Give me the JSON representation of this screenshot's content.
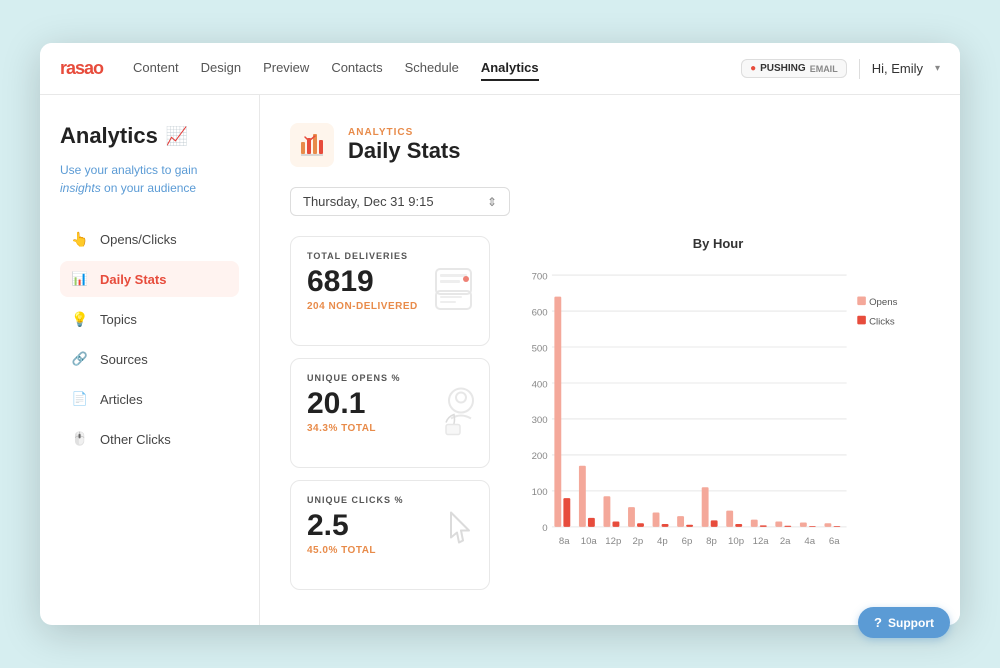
{
  "app": {
    "logo": "rasa",
    "logo_dot": "o"
  },
  "nav": {
    "links": [
      {
        "label": "Content",
        "active": false
      },
      {
        "label": "Design",
        "active": false
      },
      {
        "label": "Preview",
        "active": false
      },
      {
        "label": "Contacts",
        "active": false
      },
      {
        "label": "Schedule",
        "active": false
      },
      {
        "label": "Analytics",
        "active": true
      }
    ],
    "badge_text": "PUSHING",
    "user": "Hi, Emily"
  },
  "sidebar": {
    "title": "Analytics",
    "subtitle_1": "Use your analytics to gain",
    "subtitle_highlight": "insights",
    "subtitle_2": "on your audience",
    "items": [
      {
        "label": "Opens/Clicks",
        "icon": "👆",
        "active": false
      },
      {
        "label": "Daily Stats",
        "icon": "📊",
        "active": true
      },
      {
        "label": "Topics",
        "icon": "💡",
        "active": false
      },
      {
        "label": "Sources",
        "icon": "🔗",
        "active": false
      },
      {
        "label": "Articles",
        "icon": "📄",
        "active": false
      },
      {
        "label": "Other Clicks",
        "icon": "🖱️",
        "active": false
      }
    ]
  },
  "content": {
    "breadcrumb": "ANALYTICS",
    "title": "Daily Stats",
    "date_value": "Thursday, Dec 31 9:15"
  },
  "stats": [
    {
      "label": "TOTAL DELIVERIES",
      "value": "6819",
      "sub": "204 NON-DELIVERED"
    },
    {
      "label": "UNIQUE OPENS %",
      "value": "20.1",
      "sub": "34.3% TOTAL"
    },
    {
      "label": "UNIQUE CLICKS %",
      "value": "2.5",
      "sub": "45.0% TOTAL"
    }
  ],
  "chart": {
    "title": "By Hour",
    "legend": [
      {
        "label": "Opens",
        "color": "#f4a89a"
      },
      {
        "label": "Clicks",
        "color": "#e74c3c"
      }
    ],
    "x_labels": [
      "8a",
      "10a",
      "12p",
      "2p",
      "4p",
      "6p",
      "8p",
      "10p",
      "12a",
      "2a",
      "4a",
      "6a"
    ],
    "opens_data": [
      640,
      170,
      85,
      55,
      40,
      30,
      110,
      45,
      20,
      15,
      12,
      10
    ],
    "clicks_data": [
      80,
      25,
      15,
      10,
      8,
      6,
      18,
      8,
      4,
      3,
      2,
      2
    ],
    "y_max": 700,
    "y_ticks": [
      700,
      600,
      500,
      400,
      300,
      200,
      100,
      0
    ]
  },
  "support": {
    "label": "Support"
  }
}
